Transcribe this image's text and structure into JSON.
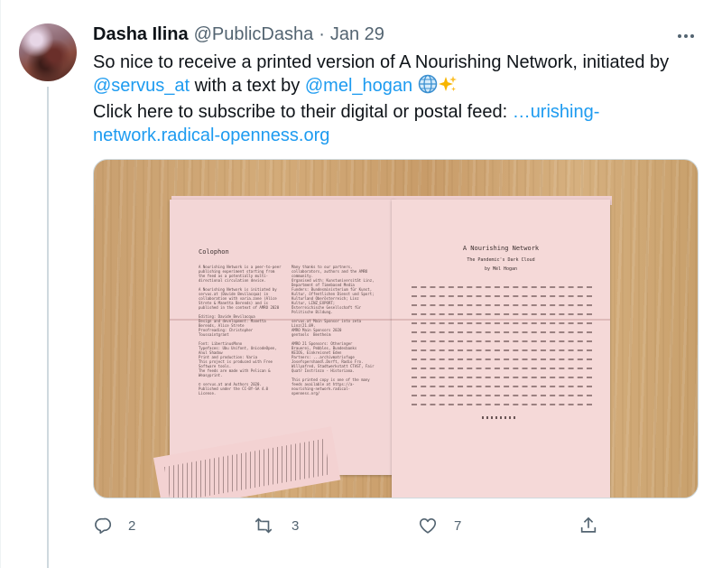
{
  "tweet": {
    "display_name": "Dasha Ilina",
    "handle": "@PublicDasha",
    "separator": "·",
    "date": "Jan 29",
    "text_part1": "So nice to receive a printed version of A Nourishing Network, initiated by ",
    "mention1": "@servus_at",
    "text_part2": " with a text by ",
    "mention2": "@mel_hogan",
    "emojis": "🌐✨",
    "text_part3": "Click here to subscribe to their digital or postal feed: ",
    "url": "…urishing-network.radical-openness.org"
  },
  "photo": {
    "left_page_heading": "Colophon",
    "right_page_title": "A Nourishing Network",
    "right_page_subtitle": "The Pandemic's Dark Cloud",
    "right_page_byline": "by Mél Hogan"
  },
  "actions": {
    "reply_count": "2",
    "retweet_count": "3",
    "like_count": "7"
  },
  "icons": [
    "more-icon",
    "reply-icon",
    "retweet-icon",
    "like-icon",
    "share-icon",
    "globe-emoji",
    "sparkles-emoji"
  ],
  "colors": {
    "link": "#1d9bf0",
    "secondary": "#536471",
    "text": "#0f1419"
  }
}
